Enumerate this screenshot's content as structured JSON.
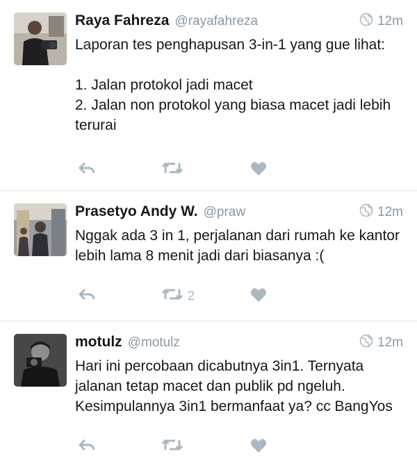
{
  "tweets": [
    {
      "name": "Raya Fahreza",
      "handle": "@rayafahreza",
      "time": "12m",
      "text": "Laporan tes penghapusan 3-in-1 yang gue lihat:\n\n1. Jalan protokol jadi macet\n2. Jalan non protokol yang biasa macet jadi lebih terurai",
      "retweets": "",
      "likes": ""
    },
    {
      "name": "Prasetyo Andy W.",
      "handle": "@praw",
      "time": "12m",
      "text": "Nggak ada 3 in 1, perjalanan dari rumah ke kantor lebih lama 8 menit jadi dari biasanya :(",
      "retweets": "2",
      "likes": ""
    },
    {
      "name": "motulz",
      "handle": "@motulz",
      "time": "12m",
      "text": "Hari ini percobaan dicabutnya 3in1. Ternyata jalanan tetap macet dan publik pd ngeluh. Kesimpulannya 3in1 bermanfaat ya? cc BangYos",
      "retweets": "",
      "likes": ""
    }
  ],
  "colors": {
    "text": "#14171a",
    "secondary": "#8899a6",
    "icon": "#aab8c2",
    "divider": "#e1e8ed"
  },
  "icons": [
    "globe-icon",
    "reply-icon",
    "retweet-icon",
    "heart-icon"
  ]
}
